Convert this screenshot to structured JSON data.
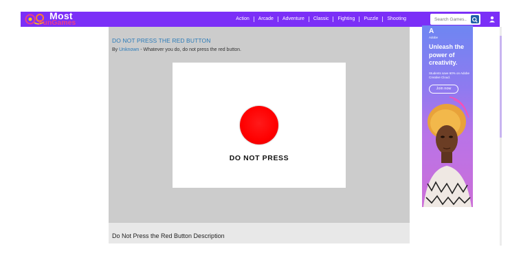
{
  "header": {
    "logo": {
      "word1": "Most",
      "word2": "FunGames"
    },
    "nav": [
      "Action",
      "Arcade",
      "Adventure",
      "Classic",
      "Fighting",
      "Puzzle",
      "Shooting"
    ],
    "search_placeholder": "Search Games..",
    "accent_color": "#7b2ff7"
  },
  "game": {
    "title": "DO NOT PRESS THE RED BUTTON",
    "by_prefix": "By",
    "author": "Unknown",
    "tagline": " - Whatever you do, do not press the red button.",
    "button_label": "DO NOT PRESS",
    "button_color": "#ff0000"
  },
  "description": {
    "title": "Do Not Press the Red Button Description"
  },
  "ad": {
    "logo": "A",
    "brand": "Adobe",
    "headline": "Unleash the power of creativity.",
    "sub": "Students save 60% on Adobe Creative Cloud.",
    "cta": "Join now"
  }
}
